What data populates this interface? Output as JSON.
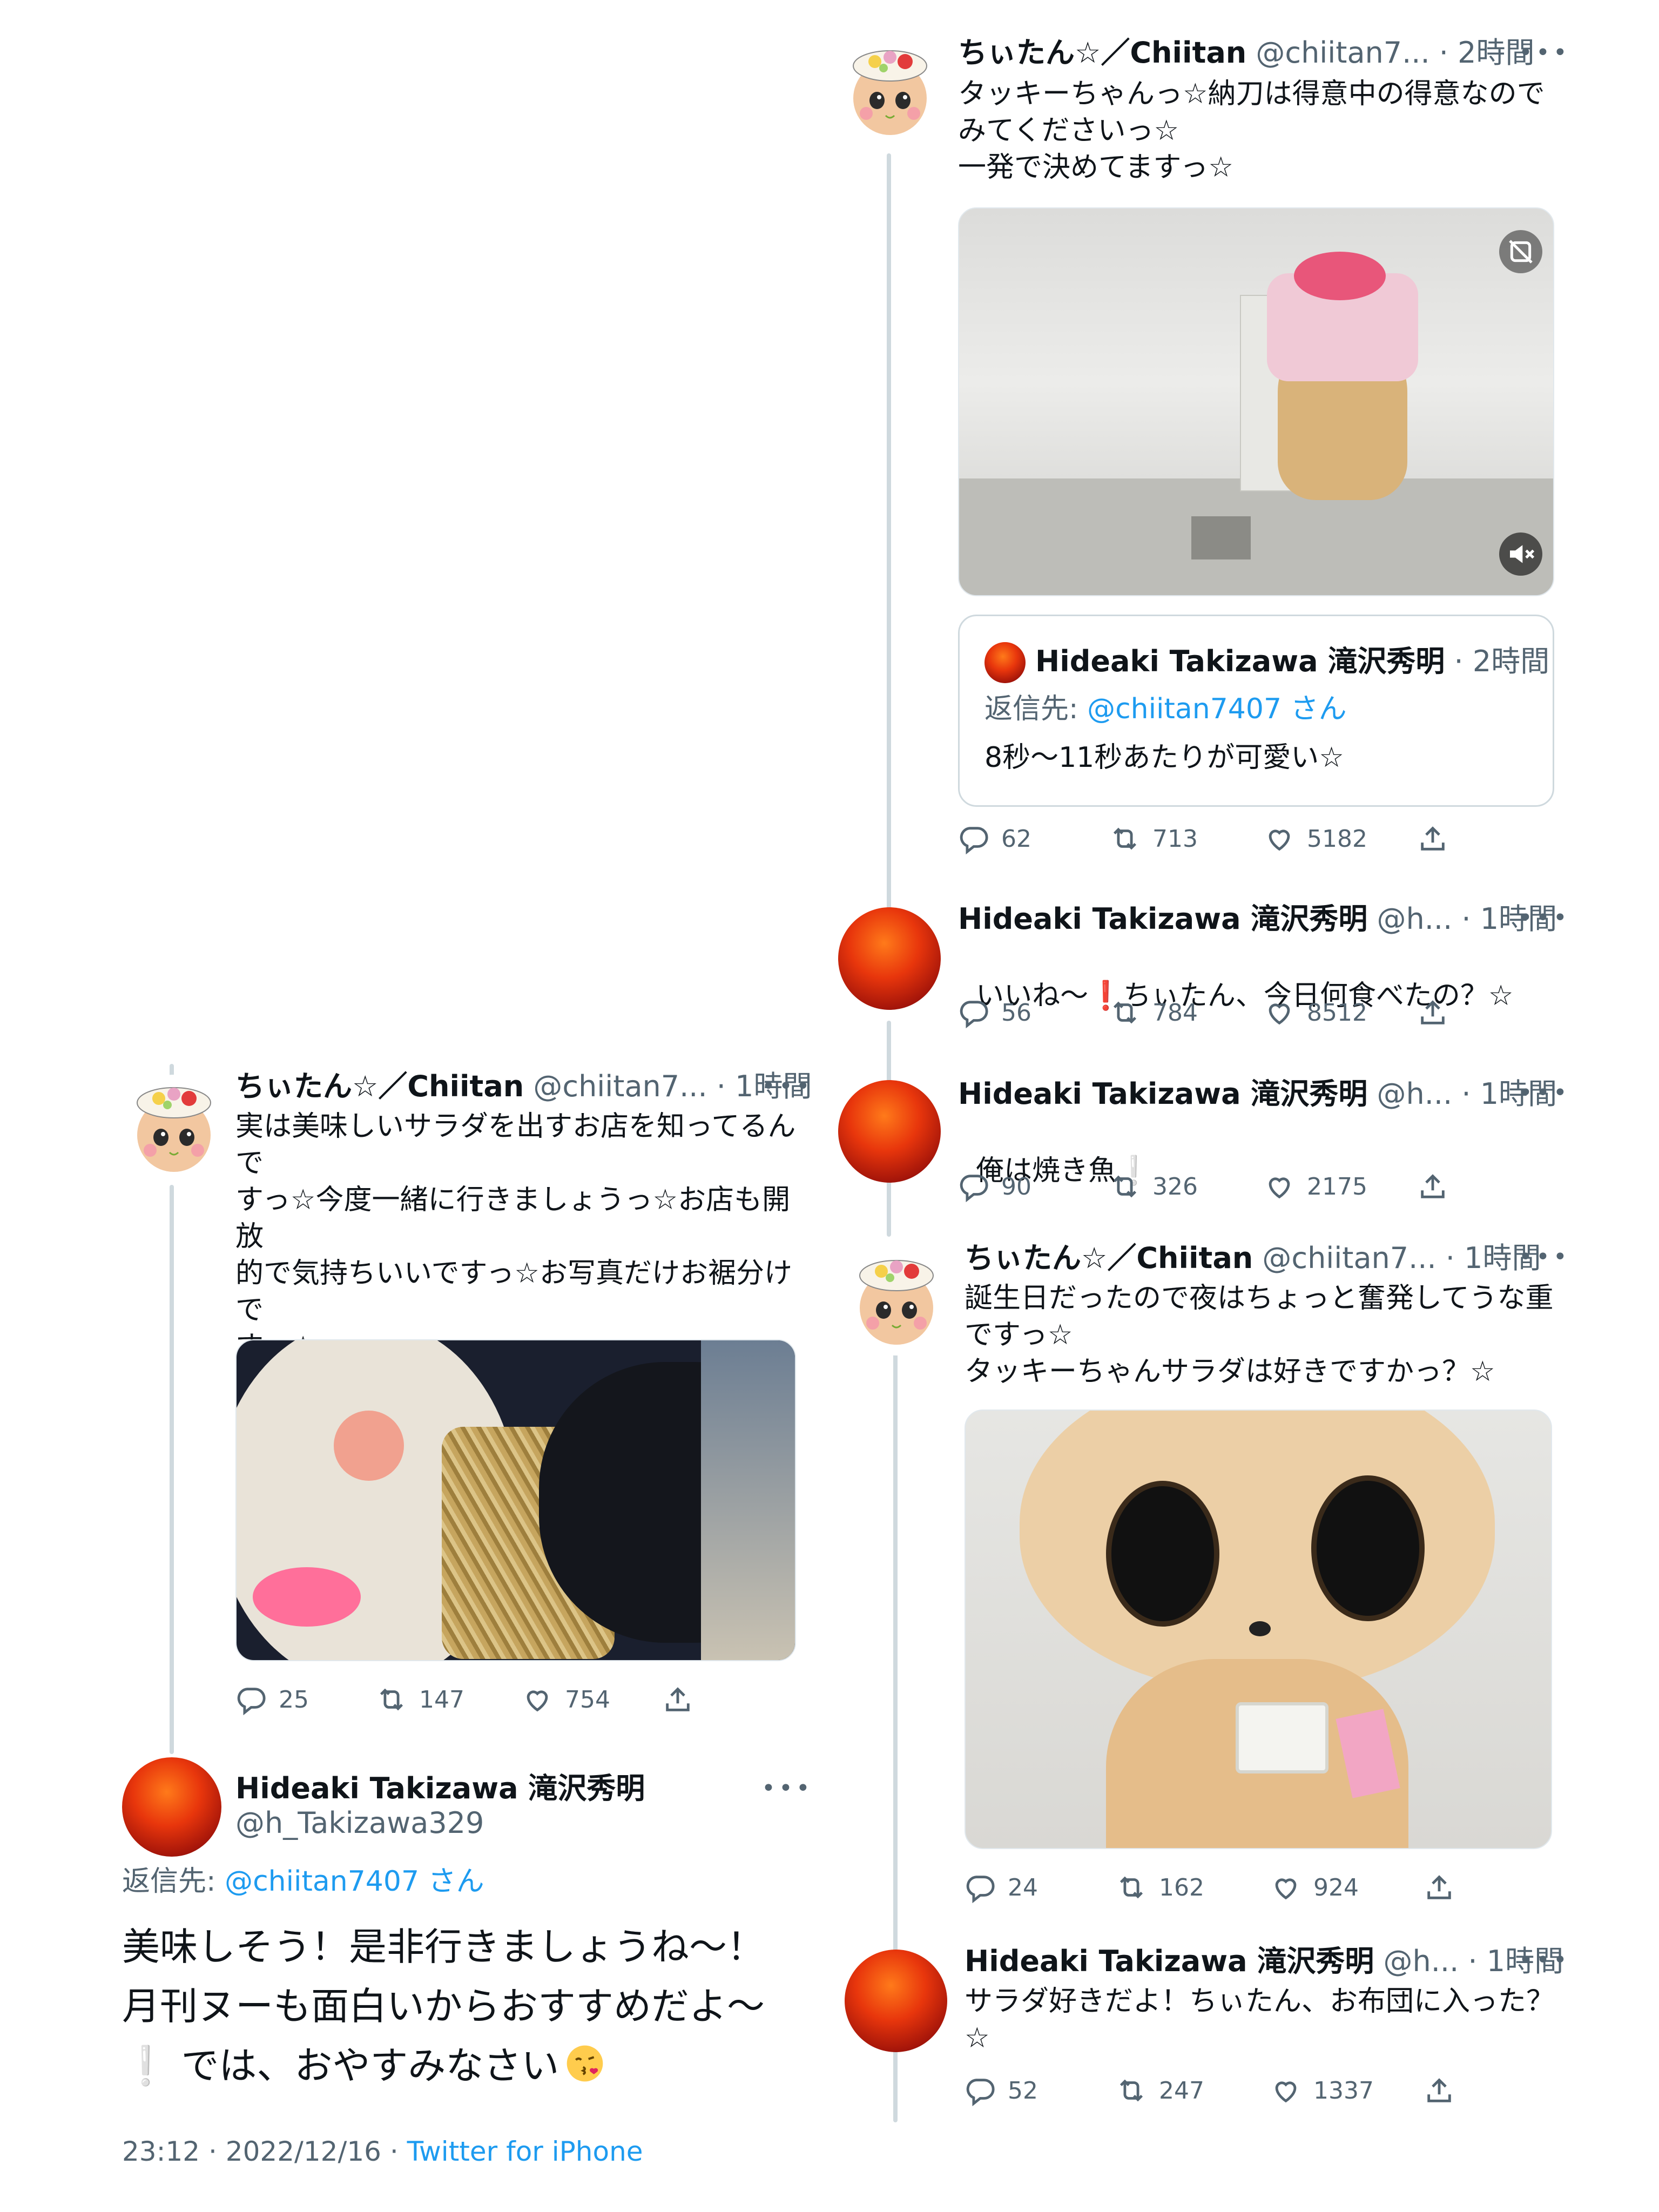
{
  "right_thread": {
    "tweet1": {
      "name": "ちぃたん☆／Chiitan",
      "handle_time": "@chiitan7... · 2時間",
      "text": "タッキーちゃんっ☆納刀は得意中の得意なので\nみてくださいっ☆\n一発で決めてますっ☆",
      "quote": {
        "name": "Hideaki Takizawa 滝沢秀明",
        "time": "· 2時間",
        "reply_label": "返信先:",
        "reply_handle": "@chiitan7407 さん",
        "text": "8秒〜11秒あたりが可愛い☆"
      },
      "replies": "62",
      "retweets": "713",
      "likes": "5182"
    },
    "tweet2": {
      "name": "Hideaki Takizawa 滝沢秀明",
      "handle_time": "@h... · 1時間",
      "text_a": "いいね〜",
      "text_b": "ちぃたん、今日何食べたの？☆",
      "replies": "56",
      "retweets": "784",
      "likes": "8512"
    },
    "tweet3": {
      "name": "Hideaki Takizawa 滝沢秀明",
      "handle_time": "@h... · 1時間",
      "text": "俺は焼き魚",
      "replies": "90",
      "retweets": "326",
      "likes": "2175"
    },
    "tweet4": {
      "name": "ちぃたん☆／Chiitan",
      "handle_time": "@chiitan7... · 1時間",
      "text": "誕生日だったので夜はちょっと奮発してうな重\nですっ☆\nタッキーちゃんサラダは好きですかっ？☆",
      "replies": "24",
      "retweets": "162",
      "likes": "924"
    },
    "tweet5": {
      "name": "Hideaki Takizawa 滝沢秀明",
      "handle_time": "@h... · 1時間",
      "text": "サラダ好きだよ！ちぃたん、お布団に入った？\n☆",
      "replies": "52",
      "retweets": "247",
      "likes": "1337"
    }
  },
  "left_thread": {
    "tweet1": {
      "name": "ちぃたん☆／Chiitan",
      "handle_time": "@chiitan7... · 1時間",
      "text": "実は美味しいサラダを出すお店を知ってるんで\nすっ☆今度一緒に行きましょうっ☆お店も開放\n的で気持ちいいですっ☆お写真だけお裾分けで\nすっ☆\n今は月刊ムーを読んでるのでお布団はまだです\nっ☆タッキーちゃんはお布団ですかっ？☆",
      "replies": "25",
      "retweets": "147",
      "likes": "754"
    },
    "main": {
      "name": "Hideaki Takizawa 滝沢秀明",
      "handle": "@h_Takizawa329",
      "reply_label": "返信先:",
      "reply_handle": "@chiitan7407 さん",
      "line1": "美味しそう！是非行きましょうね〜！",
      "line2": "月刊ヌーも面白いからおすすめだよ〜",
      "line3": "では、おやすみなさい",
      "timestamp": "23:12 · 2022/12/16 · ",
      "client": "Twitter for iPhone"
    }
  },
  "icons": {
    "reply": "speech-bubble-icon",
    "retweet": "retweet-arrows-icon",
    "like": "heart-icon",
    "share": "share-upload-icon",
    "more": "more-dots-icon",
    "mute": "speaker-muted-icon"
  },
  "colors": {
    "link": "#1d9bf0",
    "muted": "#536471",
    "line": "#cfd9de",
    "exclaim": "#e0245e"
  }
}
